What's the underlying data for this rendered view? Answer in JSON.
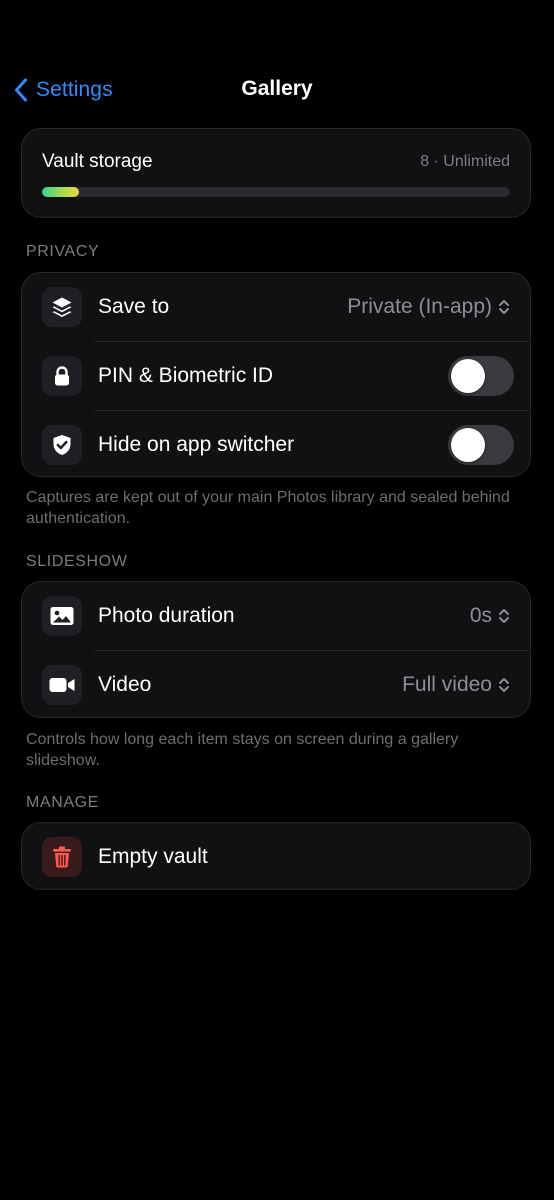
{
  "nav": {
    "back_label": "Settings",
    "title": "Gallery"
  },
  "storage": {
    "label": "Vault storage",
    "value": "8 · Unlimited",
    "usage_fraction": 0.08
  },
  "privacy": {
    "header": "PRIVACY",
    "save_to": {
      "label": "Save to",
      "value": "Private (In-app)",
      "icon": "layers-icon"
    },
    "pin": {
      "label": "PIN & Biometric ID",
      "enabled": false,
      "icon": "lock-icon"
    },
    "hide": {
      "label": "Hide on app switcher",
      "enabled": false,
      "icon": "shield-check-icon"
    },
    "footnote": "Captures are kept out of your main Photos library and sealed behind authentication."
  },
  "slideshow": {
    "header": "SLIDESHOW",
    "photo_duration": {
      "label": "Photo duration",
      "value": "0s",
      "icon": "photo-icon"
    },
    "video": {
      "label": "Video",
      "value": "Full video",
      "icon": "video-camera-icon"
    },
    "footnote": "Controls how long each item stays on screen during a gallery slideshow."
  },
  "manage": {
    "header": "MANAGE",
    "empty_vault": {
      "label": "Empty vault",
      "icon": "trash-icon"
    }
  },
  "colors": {
    "accent": "#2f8cff",
    "danger": "#ff5a4f",
    "background": "#000000",
    "card": "#111114"
  }
}
